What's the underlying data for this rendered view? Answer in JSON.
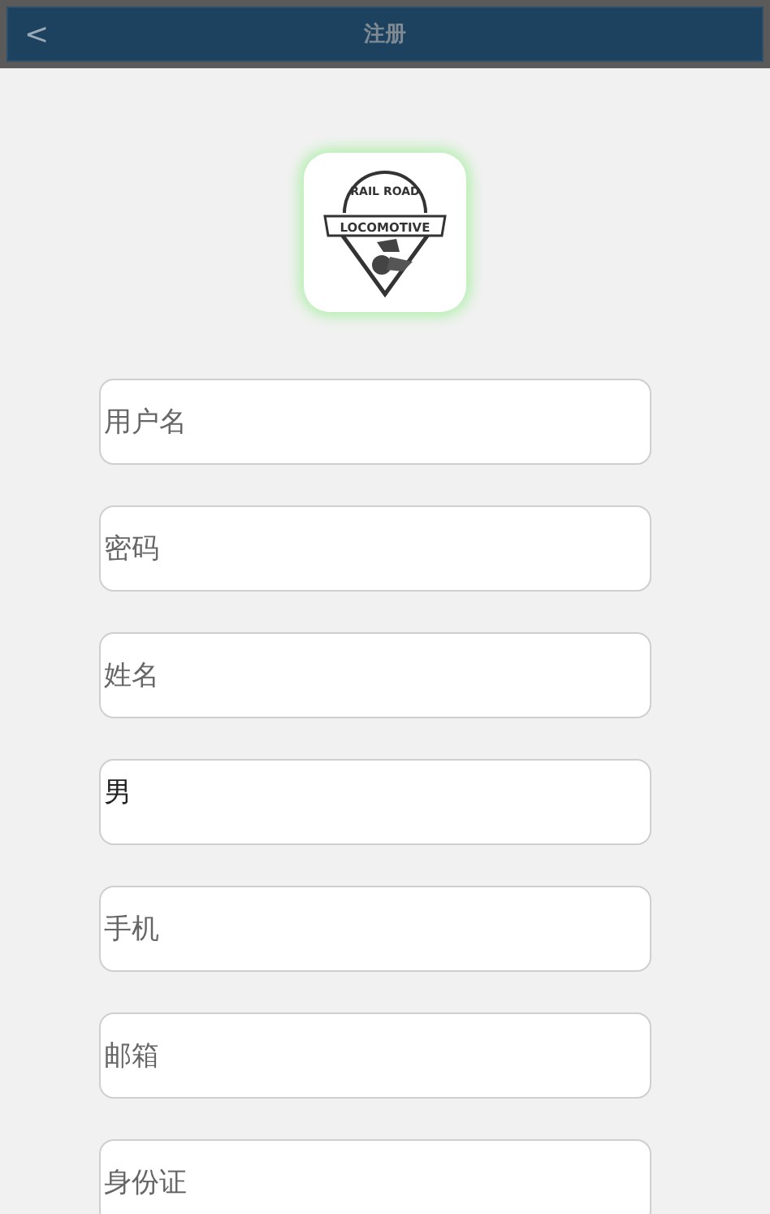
{
  "header": {
    "back": "<",
    "title": "注册"
  },
  "logo": {
    "top_text": "RAIL ROAD",
    "banner_text": "LOCOMOTIVE"
  },
  "fields": [
    {
      "kind": "input",
      "placeholder": "用户名"
    },
    {
      "kind": "input",
      "placeholder": "密码"
    },
    {
      "kind": "input",
      "placeholder": "姓名"
    },
    {
      "kind": "select",
      "value": "男"
    },
    {
      "kind": "input",
      "placeholder": "手机"
    },
    {
      "kind": "input",
      "placeholder": "邮箱"
    },
    {
      "kind": "input",
      "placeholder": "身份证"
    }
  ]
}
